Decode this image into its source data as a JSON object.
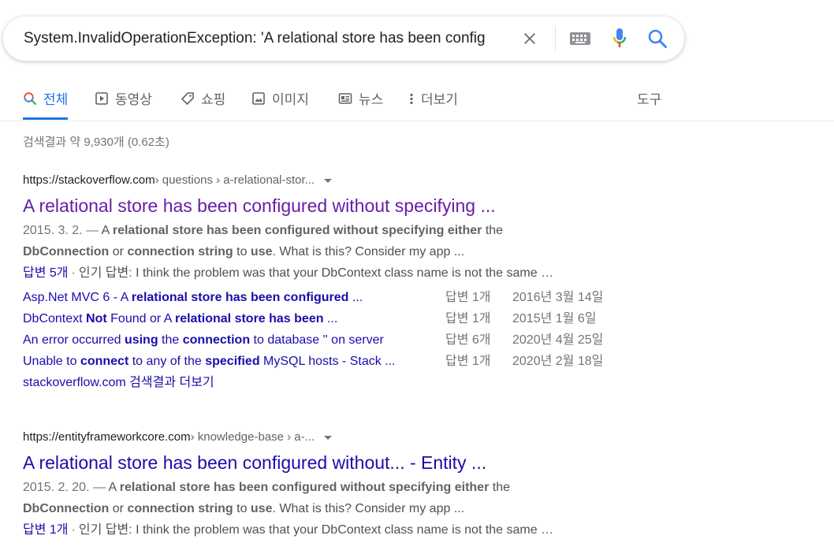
{
  "search": {
    "query": "System.InvalidOperationException: 'A relational store has been config"
  },
  "tabs": [
    {
      "label": "전체",
      "icon": "search-icon",
      "active": true
    },
    {
      "label": "동영상",
      "icon": "video-play-icon"
    },
    {
      "label": "쇼핑",
      "icon": "tag-icon"
    },
    {
      "label": "이미지",
      "icon": "image-icon"
    },
    {
      "label": "뉴스",
      "icon": "news-icon"
    },
    {
      "label": "더보기",
      "icon": "more-vert-icon"
    },
    {
      "label": "도구"
    }
  ],
  "stats": "검색결과 약 9,930개 (0.62초)",
  "results": [
    {
      "cite_domain": "https://stackoverflow.com",
      "cite_path": " › questions › a-relational-stor...",
      "title": "A relational store has been configured without specifying ...",
      "snippet": {
        "date": "2015. 3. 2. — ",
        "p1": "A ",
        "b1": "relational store has been configured without specifying either",
        "p2": " the",
        "b2": "DbConnection",
        "p3": " or ",
        "b3": "connection string",
        "p4": " to ",
        "b4": "use",
        "p5": ". What is this? Consider my app ..."
      },
      "answers_label": "답변 5개",
      "sep": "·",
      "top_answer_prefix": "인기 답변:",
      "top_answer": " I think the problem was that your DbContext class name is not the same …",
      "related": [
        {
          "parts": [
            {
              "t": "Asp.Net MVC 6 - A ",
              "b": false
            },
            {
              "t": "relational store has been configured",
              "b": true
            },
            {
              "t": " ...",
              "b": false
            }
          ],
          "count": "답변 1개",
          "date": "2016년 3월 14일"
        },
        {
          "parts": [
            {
              "t": "DbContext ",
              "b": false
            },
            {
              "t": "Not",
              "b": true
            },
            {
              "t": " Found or A ",
              "b": false
            },
            {
              "t": "relational store has been",
              "b": true
            },
            {
              "t": " ...",
              "b": false
            }
          ],
          "count": "답변 1개",
          "date": "2015년 1월 6일"
        },
        {
          "parts": [
            {
              "t": "An error occurred ",
              "b": false
            },
            {
              "t": "using",
              "b": true
            },
            {
              "t": " the ",
              "b": false
            },
            {
              "t": "connection",
              "b": true
            },
            {
              "t": " to database '' on server",
              "b": false
            }
          ],
          "count": "답변 6개",
          "date": "2020년 4월 25일"
        },
        {
          "parts": [
            {
              "t": "Unable to ",
              "b": false
            },
            {
              "t": "connect",
              "b": true
            },
            {
              "t": " to any of the ",
              "b": false
            },
            {
              "t": "specified",
              "b": true
            },
            {
              "t": " MySQL hosts - Stack ...",
              "b": false
            }
          ],
          "count": "답변 1개",
          "date": "2020년 2월 18일"
        }
      ],
      "more_label": "stackoverflow.com 검색결과 더보기"
    },
    {
      "cite_domain": "https://entityframeworkcore.com",
      "cite_path": " › knowledge-base › a-...",
      "title": "A relational store has been configured without... - Entity ...",
      "snippet": {
        "date": "2015. 2. 20. — ",
        "p1": "A ",
        "b1": "relational store has been configured without specifying either",
        "p2": " the",
        "b2": "DbConnection",
        "p3": " or ",
        "b3": "connection string",
        "p4": " to ",
        "b4": "use",
        "p5": ". What is this? Consider my app ..."
      },
      "answers_label": "답변 1개",
      "sep": "·",
      "top_answer_prefix": "인기 답변:",
      "top_answer": " I think the problem was that your DbContext class name is not the same …"
    }
  ]
}
